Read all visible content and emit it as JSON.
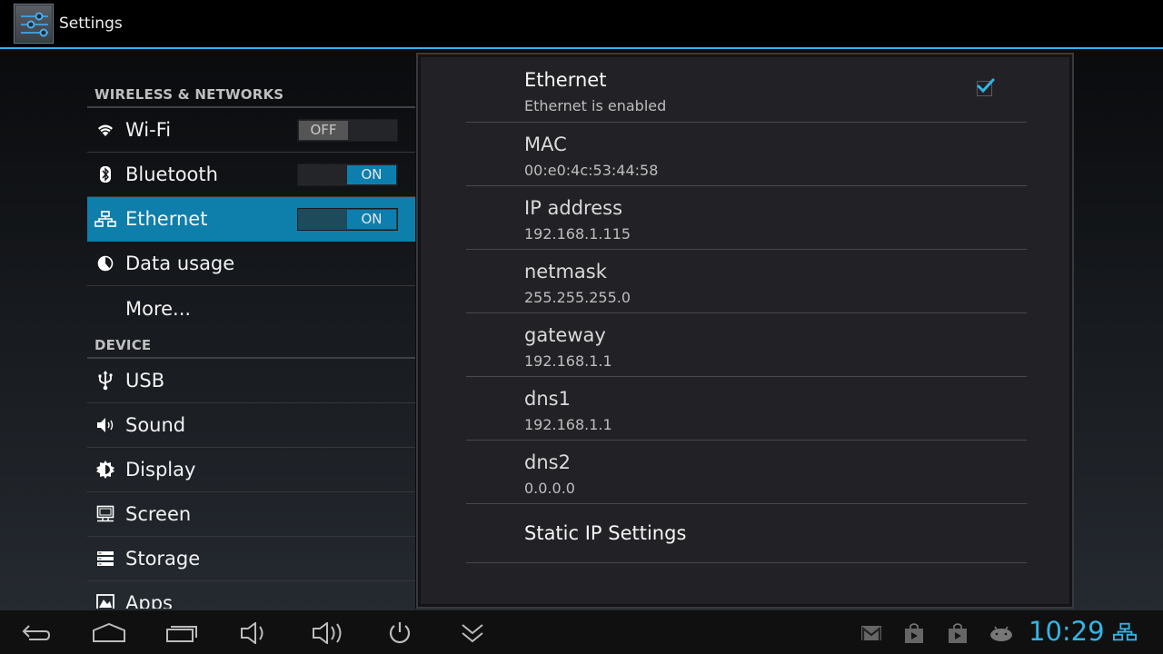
{
  "actionbar": {
    "title": "Settings",
    "icon": "settings-sliders-icon"
  },
  "sidebar": {
    "sections": [
      {
        "header": "WIRELESS & NETWORKS",
        "items": [
          {
            "label": "Wi-Fi",
            "icon": "wifi-icon",
            "toggle": "OFF"
          },
          {
            "label": "Bluetooth",
            "icon": "bluetooth-icon",
            "toggle": "ON"
          },
          {
            "label": "Ethernet",
            "icon": "ethernet-icon",
            "toggle": "ON",
            "selected": true
          },
          {
            "label": "Data usage",
            "icon": "data-usage-icon"
          },
          {
            "label": "More..."
          }
        ]
      },
      {
        "header": "DEVICE",
        "items": [
          {
            "label": "USB",
            "icon": "usb-icon"
          },
          {
            "label": "Sound",
            "icon": "sound-icon"
          },
          {
            "label": "Display",
            "icon": "display-icon"
          },
          {
            "label": "Screen",
            "icon": "screen-icon"
          },
          {
            "label": "Storage",
            "icon": "storage-icon"
          },
          {
            "label": "Apps",
            "icon": "apps-icon"
          }
        ]
      }
    ]
  },
  "details": {
    "ethernet": {
      "title": "Ethernet",
      "summary": "Ethernet is enabled",
      "checked": true
    },
    "info": [
      {
        "title": "MAC",
        "value": "00:e0:4c:53:44:58"
      },
      {
        "title": "IP address",
        "value": "192.168.1.115"
      },
      {
        "title": "netmask",
        "value": "255.255.255.0"
      },
      {
        "title": "gateway",
        "value": "192.168.1.1"
      },
      {
        "title": "dns1",
        "value": "192.168.1.1"
      },
      {
        "title": "dns2",
        "value": "0.0.0.0"
      }
    ],
    "static_ip": {
      "title": "Static IP Settings"
    }
  },
  "navbar": {
    "buttons": [
      "back",
      "home",
      "recent-apps",
      "volume-down",
      "volume-up",
      "power",
      "collapse"
    ],
    "status_icons": [
      "gmail",
      "play-store",
      "play-store",
      "android"
    ],
    "clock": "10:29",
    "network_icon": "ethernet-connected",
    "accent": "#33b5e5"
  },
  "colors": {
    "accent": "#33b5e5",
    "selected": "#0e7eab",
    "toggle_on": "#0d7fae"
  }
}
